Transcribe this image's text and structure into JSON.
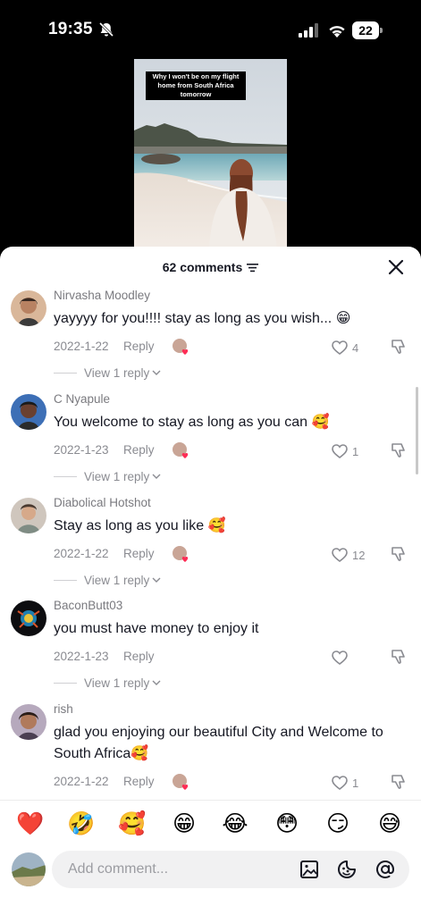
{
  "status_bar": {
    "time": "19:35",
    "battery": "22"
  },
  "video": {
    "caption": "Why I won't be on my flight\nhome from South Africa\ntomorrow"
  },
  "sheet": {
    "comments_count": "62 comments"
  },
  "comments": [
    {
      "username": "Nirvasha Moodley",
      "text": "yayyyy for you!!!! stay as long as you wish... 😁",
      "date": "2022-1-22",
      "reply_label": "Reply",
      "likes": "4",
      "view_replies": "View 1 reply"
    },
    {
      "username": "C Nyapule",
      "text": "You welcome to stay as long as you can 🥰",
      "date": "2022-1-23",
      "reply_label": "Reply",
      "likes": "1",
      "view_replies": "View 1 reply"
    },
    {
      "username": "Diabolical Hotshot",
      "text": "Stay as long as you like 🥰",
      "date": "2022-1-22",
      "reply_label": "Reply",
      "likes": "12",
      "view_replies": "View 1 reply"
    },
    {
      "username": "BaconButt03",
      "text": "you must have money to enjoy it",
      "date": "2022-1-23",
      "reply_label": "Reply",
      "likes": "",
      "view_replies": "View 1 reply"
    },
    {
      "username": "rish",
      "text": "glad you enjoying our beautiful City and Welcome to South Africa🥰",
      "date": "2022-1-22",
      "reply_label": "Reply",
      "likes": "1",
      "view_replies": ""
    }
  ],
  "emoji_bar": [
    "❤️",
    "🤣",
    "🥰",
    "😁",
    "😂",
    "😳",
    "😏",
    "😅"
  ],
  "input": {
    "placeholder": "Add comment..."
  },
  "icons": {
    "close": "close-icon",
    "filter": "filter-icon",
    "like": "heart-icon",
    "dislike": "thumbs-down-icon",
    "image": "image-icon",
    "emoji": "emoji-icon",
    "mention": "at-icon"
  },
  "colors": {
    "text_primary": "#161823",
    "text_secondary": "#8a8b91",
    "heart_red": "#fe2c55"
  }
}
